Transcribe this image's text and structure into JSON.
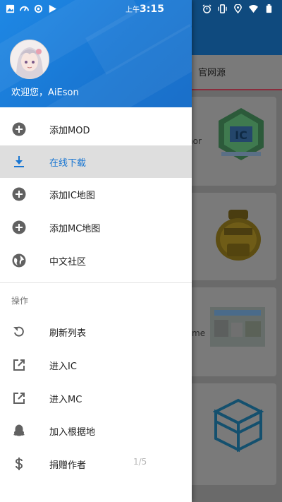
{
  "status_bar": {
    "time_prefix": "上午",
    "time": "3:15",
    "left_icons": [
      "image-icon",
      "speed-icon",
      "sync-icon",
      "play-store-icon"
    ],
    "right_icons": [
      "alarm-icon",
      "vibrate-icon",
      "location-icon",
      "wifi-icon",
      "battery-icon"
    ]
  },
  "background": {
    "tab_label": "官网源",
    "card_snippets": [
      "nor",
      "me"
    ]
  },
  "drawer": {
    "welcome": "欢迎您，AiEson",
    "items": [
      {
        "label": "添加MOD",
        "icon": "add-circle-icon"
      },
      {
        "label": "在线下载",
        "icon": "download-icon",
        "active": true
      },
      {
        "label": "添加IC地图",
        "icon": "add-circle-icon"
      },
      {
        "label": "添加MC地图",
        "icon": "add-circle-icon"
      },
      {
        "label": "中文社区",
        "icon": "globe-icon"
      }
    ],
    "section_title": "操作",
    "actions": [
      {
        "label": "刷新列表",
        "icon": "refresh-icon"
      },
      {
        "label": "进入IC",
        "icon": "open-external-icon"
      },
      {
        "label": "进入MC",
        "icon": "open-external-icon"
      },
      {
        "label": "加入根据地",
        "icon": "qq-penguin-icon"
      },
      {
        "label": "捐赠作者",
        "icon": "dollar-icon"
      }
    ],
    "page_indicator": "1/5"
  },
  "colors": {
    "header_blue": "#1e88e5",
    "active_text": "#1976d2",
    "active_bg": "#dedede",
    "icon_gray": "#616161"
  }
}
